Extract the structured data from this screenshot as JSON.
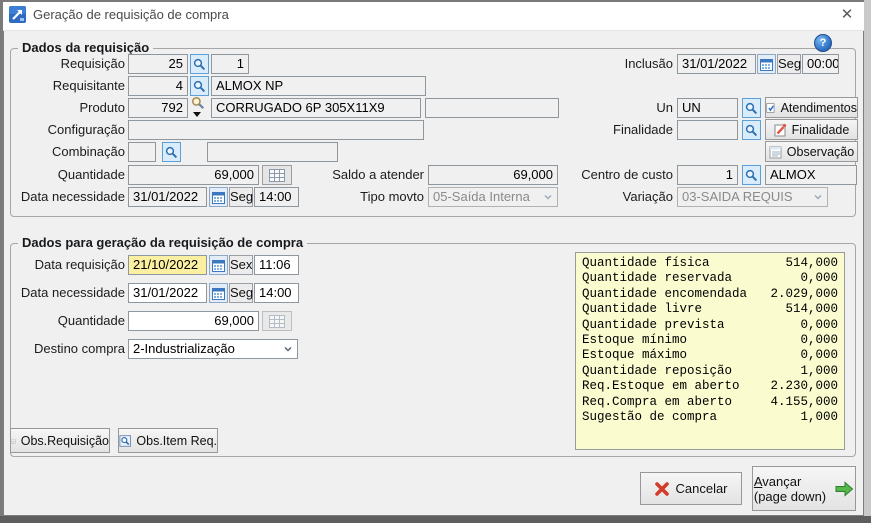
{
  "window": {
    "title": "Geração de requisição de compra"
  },
  "icons": {
    "close": "✕",
    "help": "?"
  },
  "g1": {
    "title": "Dados da requisição",
    "requisicao_label": "Requisição",
    "requisicao_num": "25",
    "requisicao_item": "1",
    "requisitante_label": "Requisitante",
    "requisitante_num": "4",
    "requisitante_nome": "ALMOX NP",
    "produto_label": "Produto",
    "produto_num": "792",
    "produto_desc": "CORRUGADO 6P 305X11X9",
    "produto_extra": "",
    "configuracao_label": "Configuração",
    "configuracao": "",
    "combinacao_label": "Combinação",
    "combinacao_num": "",
    "combinacao_desc": "",
    "quantidade_label": "Quantidade",
    "quantidade": "69,000",
    "data_necessidade_label": "Data necessidade",
    "data_necessidade": "31/01/2022",
    "data_necessidade_dow": "Seg",
    "data_necessidade_hora": "14:00",
    "saldo_label": "Saldo a atender",
    "saldo": "69,000",
    "tipo_movto_label": "Tipo movto",
    "tipo_movto": "05-Saída Interna",
    "inclusao_label": "Inclusão",
    "inclusao_data": "31/01/2022",
    "inclusao_dow": "Seg",
    "inclusao_hora": "00:00",
    "un_label": "Un",
    "un": "UN",
    "atendimentos_btn": "Atendimentos",
    "finalidade_label": "Finalidade",
    "finalidade": "",
    "finalidade_btn": "Finalidade",
    "observacao_btn": "Observação",
    "centro_custo_label": "Centro de custo",
    "centro_custo_num": "1",
    "centro_custo_nome": "ALMOX",
    "variacao_label": "Variação",
    "variacao": "03-SAIDA REQUIS"
  },
  "g2": {
    "title": "Dados para geração da requisição de compra",
    "data_requisicao_label": "Data requisição",
    "data_requisicao": "21/10/2022",
    "data_requisicao_dow": "Sex",
    "data_requisicao_hora": "11:06",
    "data_necessidade_label": "Data necessidade",
    "data_necessidade": "31/01/2022",
    "data_necessidade_dow": "Seg",
    "data_necessidade_hora": "14:00",
    "quantidade_label": "Quantidade",
    "quantidade": "69,000",
    "destino_label": "Destino compra",
    "destino": "2-Industrialização",
    "estoque": [
      {
        "name": "Quantidade física",
        "value": "514,000"
      },
      {
        "name": "Quantidade reservada",
        "value": "0,000"
      },
      {
        "name": "Quantidade encomendada",
        "value": "2.029,000"
      },
      {
        "name": "Quantidade livre",
        "value": "514,000"
      },
      {
        "name": "Quantidade prevista",
        "value": "0,000"
      },
      {
        "name": "Estoque mínimo",
        "value": "0,000"
      },
      {
        "name": "Estoque máximo",
        "value": "0,000"
      },
      {
        "name": "Quantidade reposição",
        "value": "1,000"
      },
      {
        "name": "Req.Estoque em aberto",
        "value": "2.230,000"
      },
      {
        "name": "Req.Compra em aberto",
        "value": "4.155,000"
      },
      {
        "name": "Sugestão de compra",
        "value": "1,000"
      }
    ]
  },
  "footer": {
    "obs_requisicao": "Obs.Requisição",
    "obs_item": "Obs.Item Req.",
    "cancelar": "Cancelar",
    "avancar_line1": "Avançar",
    "avancar_line2": "(page down)"
  }
}
